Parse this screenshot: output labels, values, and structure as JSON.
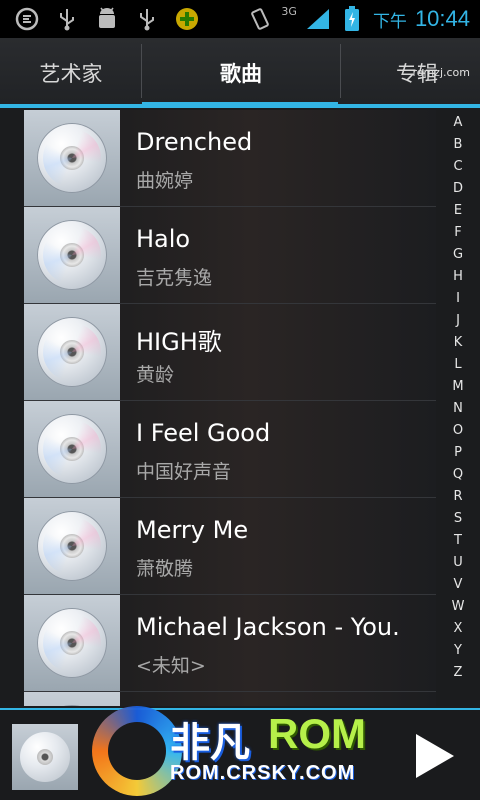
{
  "statusbar": {
    "network_label": "3G",
    "ampm": "下午",
    "time": "10:44",
    "left_icons": [
      "app-icon",
      "usb-icon",
      "android-debug-icon",
      "usb-icon",
      "plus-badge-icon"
    ]
  },
  "tabs": [
    {
      "label": "艺术家"
    },
    {
      "label": "歌曲"
    },
    {
      "label": "专辑"
    }
  ],
  "watermark_small": "romzj.com",
  "songs": [
    {
      "title": "Drenched",
      "artist": "曲婉婷"
    },
    {
      "title": "Halo",
      "artist": "吉克隽逸"
    },
    {
      "title": "HIGH歌",
      "artist": "黄龄"
    },
    {
      "title": "I Feel Good",
      "artist": "中国好声音"
    },
    {
      "title": "Merry Me",
      "artist": "萧敬腾"
    },
    {
      "title": "Michael Jackson - You.",
      "artist": "<未知>"
    },
    {
      "title": "",
      "artist": ""
    }
  ],
  "alphabet": [
    "A",
    "B",
    "C",
    "D",
    "E",
    "F",
    "G",
    "H",
    "I",
    "J",
    "K",
    "L",
    "M",
    "N",
    "O",
    "P",
    "Q",
    "R",
    "S",
    "T",
    "U",
    "V",
    "W",
    "X",
    "Y",
    "Z"
  ],
  "watermark": {
    "chinese": "非凡",
    "rom": "ROM",
    "url": "ROM.CRSKY.COM"
  },
  "colors": {
    "accent": "#33b5e5"
  }
}
